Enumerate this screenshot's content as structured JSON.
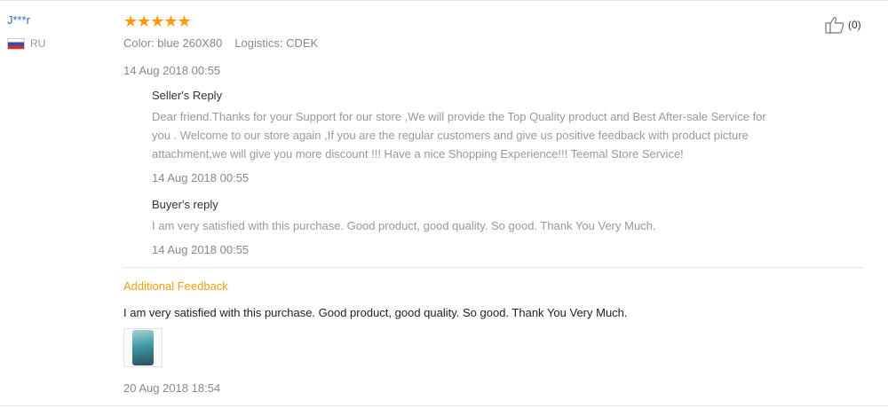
{
  "review": {
    "username": "J***r",
    "country_code": "RU",
    "rating_stars": 5,
    "stars_text": "★★★★★",
    "color_label": "Color: blue 260X80",
    "logistics_label": "Logistics: CDEK",
    "date": "14 Aug 2018 00:55",
    "likes": "(0)",
    "colors": {
      "username": "#2a6ebb",
      "stars": "#ff9a00",
      "additional": "#f39c12"
    }
  },
  "seller_reply": {
    "title": "Seller's Reply",
    "line1": "Dear friend.Thanks for your Support for our store ,We will provide the Top Quality product and Best After-sale Service for",
    "line2": "you . Welcome to our store again ,If you are the regular customers and give us positive feedback with product picture",
    "line3": "attachment,we will give you more discount !!! Have a nice Shopping Experience!!! Teemal Store Service!",
    "date": "14 Aug 2018 00:55"
  },
  "buyer_reply": {
    "title": "Buyer's reply",
    "text": "I am very satisfied with this purchase. Good product, good quality. So good. Thank You Very Much.",
    "date": "14 Aug 2018 00:55"
  },
  "additional_feedback": {
    "title": "Additional Feedback",
    "text": "I am very satisfied with this purchase. Good product, good quality. So good. Thank You Very Much.",
    "date": "20 Aug 2018 18:54"
  },
  "icons": {
    "like": "thumbs-up-icon",
    "flag": "russia-flag-icon"
  }
}
